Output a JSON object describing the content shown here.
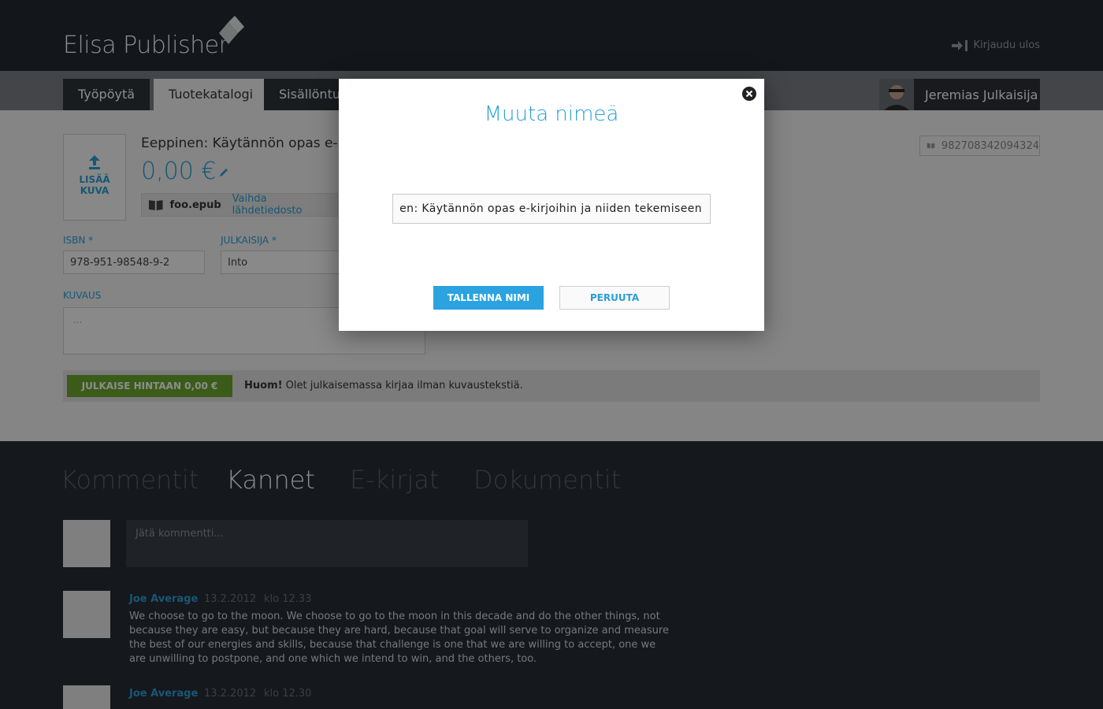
{
  "header": {
    "logo_text": "Elisa Publisher",
    "logout_label": "Kirjaudu ulos"
  },
  "nav": {
    "tabs": [
      {
        "label": "Työpöytä"
      },
      {
        "label": "Tuotekatalogi"
      },
      {
        "label": "Sisällöntuo"
      }
    ],
    "user_name": "Jeremias Julkaisija"
  },
  "product": {
    "title": "Eeppinen: Käytännön opas e-ki",
    "price": "0,00 €",
    "cover_label": "LISÄÄ KUVA",
    "file_name": "foo.epub",
    "change_file_label": "Vaihda lähdetiedosto",
    "product_code": "982708342094324",
    "isbn_label": "ISBN *",
    "isbn_value": "978-951-98548-9-2",
    "publisher_label": "JULKAISIJA *",
    "publisher_value": "Into",
    "description_label": "KUVAUS",
    "description_value": "..."
  },
  "publish": {
    "button_label": "JULKAISE HINTAAN 0,00 €",
    "note_bold": "Huom!",
    "note_text": " Olet julkaisemassa kirjaa ilman kuvaustekstiä."
  },
  "bottom_tabs": [
    {
      "label": "Kommentit"
    },
    {
      "label": "Kannet"
    },
    {
      "label": "E-kirjat"
    },
    {
      "label": "Dokumentit"
    }
  ],
  "comment_box": {
    "placeholder": "Jätä kommentti..."
  },
  "comments": [
    {
      "author": "Joe Average",
      "date": "13.2.2012",
      "time": "klo 12.33",
      "text": "We choose to go to the moon. We choose to go to the moon in this decade and do the other things, not because they are easy, but because they are hard, because that goal will serve to organize and measure the best of our energies and skills, because that challenge is one that we are willing to accept, one we are unwilling to postpone, and one which we intend to win, and the others, too."
    },
    {
      "author": "Joe Average",
      "date": "13.2.2012",
      "time": "klo 12.30",
      "text": ""
    }
  ],
  "modal": {
    "title": "Muuta nimeä",
    "input_value": "en: Käytännön opas e-kirjoihin ja niiden tekemiseen",
    "save_label": "TALLENNA NIMI",
    "cancel_label": "PERUUTA"
  },
  "colors": {
    "accent": "#2a9fd8",
    "header_bg": "#232830",
    "publish_green": "#6aa82d"
  }
}
